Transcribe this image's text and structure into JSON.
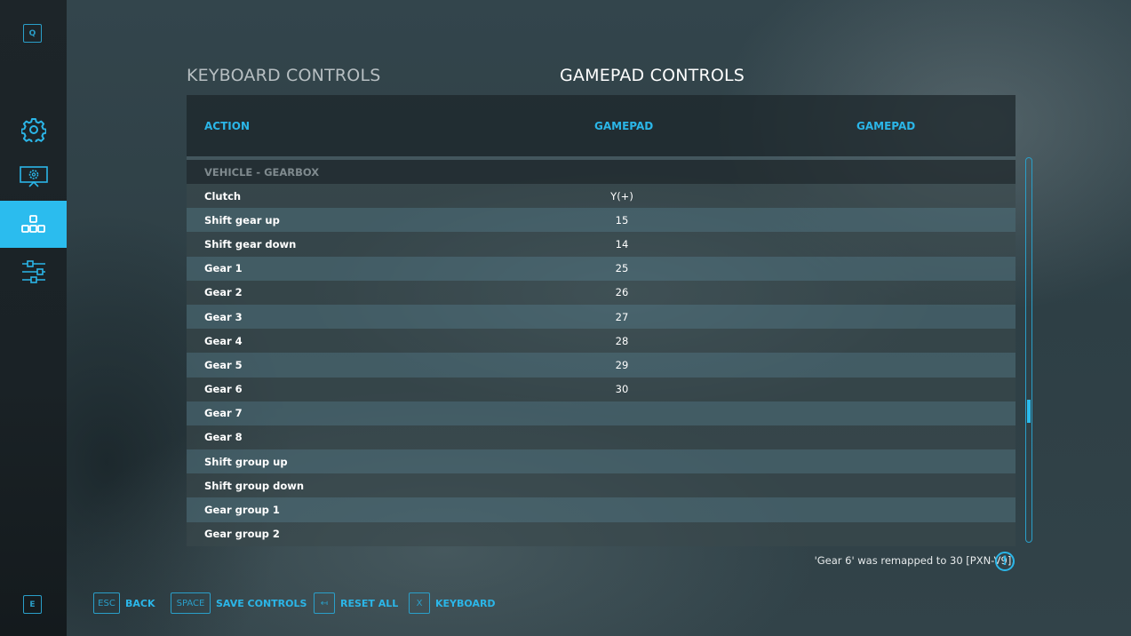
{
  "sidebar": {
    "top_key": "Q",
    "bottom_key": "E",
    "items": [
      {
        "icon": "gear-icon",
        "label": "General settings",
        "active": false
      },
      {
        "icon": "monitor-gear-icon",
        "label": "Display settings",
        "active": false
      },
      {
        "icon": "controls-icon",
        "label": "Controls",
        "active": true
      },
      {
        "icon": "sliders-icon",
        "label": "Audio / tuning settings",
        "active": false
      }
    ]
  },
  "tabs": {
    "keyboard": "KEYBOARD CONTROLS",
    "gamepad": "GAMEPAD CONTROLS",
    "active": "gamepad"
  },
  "table": {
    "columns": [
      "ACTION",
      "GAMEPAD",
      "GAMEPAD"
    ],
    "section": "VEHICLE - GEARBOX",
    "rows": [
      {
        "action": "Clutch",
        "binding1": "Y(+)",
        "binding2": ""
      },
      {
        "action": "Shift gear up",
        "binding1": "15",
        "binding2": ""
      },
      {
        "action": "Shift gear down",
        "binding1": "14",
        "binding2": ""
      },
      {
        "action": "Gear 1",
        "binding1": "25",
        "binding2": ""
      },
      {
        "action": "Gear 2",
        "binding1": "26",
        "binding2": ""
      },
      {
        "action": "Gear 3",
        "binding1": "27",
        "binding2": ""
      },
      {
        "action": "Gear 4",
        "binding1": "28",
        "binding2": ""
      },
      {
        "action": "Gear 5",
        "binding1": "29",
        "binding2": ""
      },
      {
        "action": "Gear 6",
        "binding1": "30",
        "binding2": ""
      },
      {
        "action": "Gear 7",
        "binding1": "",
        "binding2": ""
      },
      {
        "action": "Gear 8",
        "binding1": "",
        "binding2": ""
      },
      {
        "action": "Shift group up",
        "binding1": "",
        "binding2": ""
      },
      {
        "action": "Shift group down",
        "binding1": "",
        "binding2": ""
      },
      {
        "action": "Gear group 1",
        "binding1": "",
        "binding2": ""
      },
      {
        "action": "Gear group 2",
        "binding1": "",
        "binding2": ""
      }
    ],
    "scroll_position": 0.67
  },
  "notice": {
    "text": "'Gear 6' was remapped to 30 [PXN-V9].",
    "icon": "!"
  },
  "footer": {
    "buttons": [
      {
        "key": "ESC",
        "label": "BACK"
      },
      {
        "key": "SPACE",
        "label": "SAVE CONTROLS"
      },
      {
        "key": "↤",
        "label": "RESET ALL"
      },
      {
        "key": "X",
        "label": "KEYBOARD"
      }
    ]
  },
  "colors": {
    "accent": "#2bbcee",
    "accent_dark": "#2a9fc9",
    "row_light": "#4a6770",
    "row_dark": "#3a484c"
  }
}
